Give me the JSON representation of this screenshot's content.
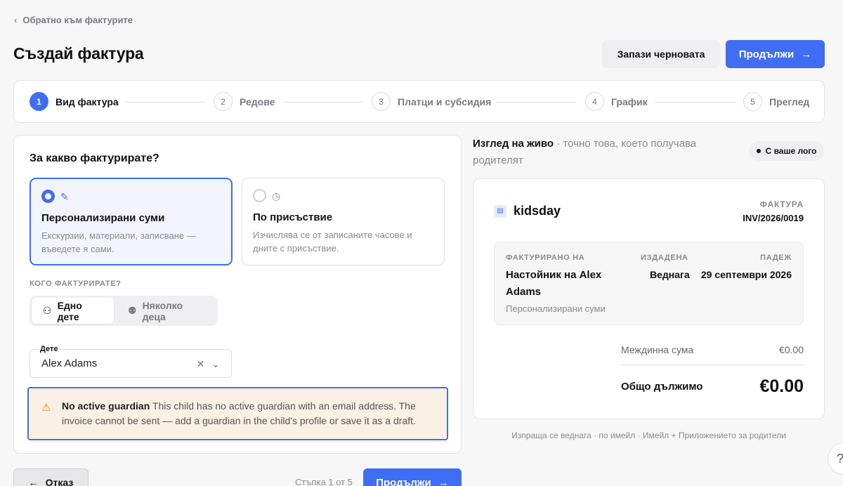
{
  "nav": {
    "back_label": "Обратно към фактурите"
  },
  "header": {
    "title": "Създай фактура",
    "save_draft_label": "Запази черновата",
    "continue_label": "Продължи"
  },
  "stepper": {
    "steps": [
      {
        "num": "1",
        "label": "Вид фактура",
        "active": true
      },
      {
        "num": "2",
        "label": "Редове",
        "active": false
      },
      {
        "num": "3",
        "label": "Платци и субсидия",
        "active": false
      },
      {
        "num": "4",
        "label": "График",
        "active": false
      },
      {
        "num": "5",
        "label": "Преглед",
        "active": false
      }
    ]
  },
  "form": {
    "heading": "За какво фактурирате?",
    "options": [
      {
        "title": "Персонализирани суми",
        "description": "Екскурзии, материали, записване — въведете я сами.",
        "selected": true,
        "icon": "pencil-icon"
      },
      {
        "title": "По присъствие",
        "description": "Изчислява се от записаните часове и дните с присъствие.",
        "selected": false,
        "icon": "clock-history-icon"
      }
    ],
    "who_label": "КОГО ФАКТУРИРАТЕ?",
    "who_options": [
      {
        "label": "Едно дете",
        "active": true,
        "icon": "person-icon"
      },
      {
        "label": "Няколко деца",
        "active": false,
        "icon": "people-icon"
      }
    ],
    "child_label": "Дете",
    "child_value": "Alex Adams",
    "warning_title": "No active guardian",
    "warning_text": "This child has no active guardian with an email address. The invoice cannot be sent — add a guardian in the child's profile or save it as a draft.",
    "cancel_label": "Отказ",
    "step_count": "Стъпка 1 от 5",
    "continue_label": "Продължи"
  },
  "preview": {
    "title_bold": "Изглед на живо",
    "title_rest": "· точно това, което получава родителят",
    "badge": "С ваше лого",
    "brand": "kidsday",
    "invoice_kind": "ФАКТУРА",
    "invoice_number": "INV/2026/0019",
    "billed_to_label": "ФАКТУРИРАНО НА",
    "billed_to_name": "Настойник на Alex Adams",
    "billed_to_sub": "Персонализирани суми",
    "issued_label": "ИЗДАДЕНА",
    "issued_value": "Веднага",
    "due_label": "ПАДЕЖ",
    "due_value": "29 септември 2026",
    "subtotal_label": "Междинна сума",
    "subtotal_value": "€0.00",
    "total_label": "Общо дължимо",
    "total_value": "€0.00",
    "footer_note": "Изпраща се веднага · по имейл · Имейл + Приложението за родители"
  },
  "help": {
    "label": "?"
  }
}
